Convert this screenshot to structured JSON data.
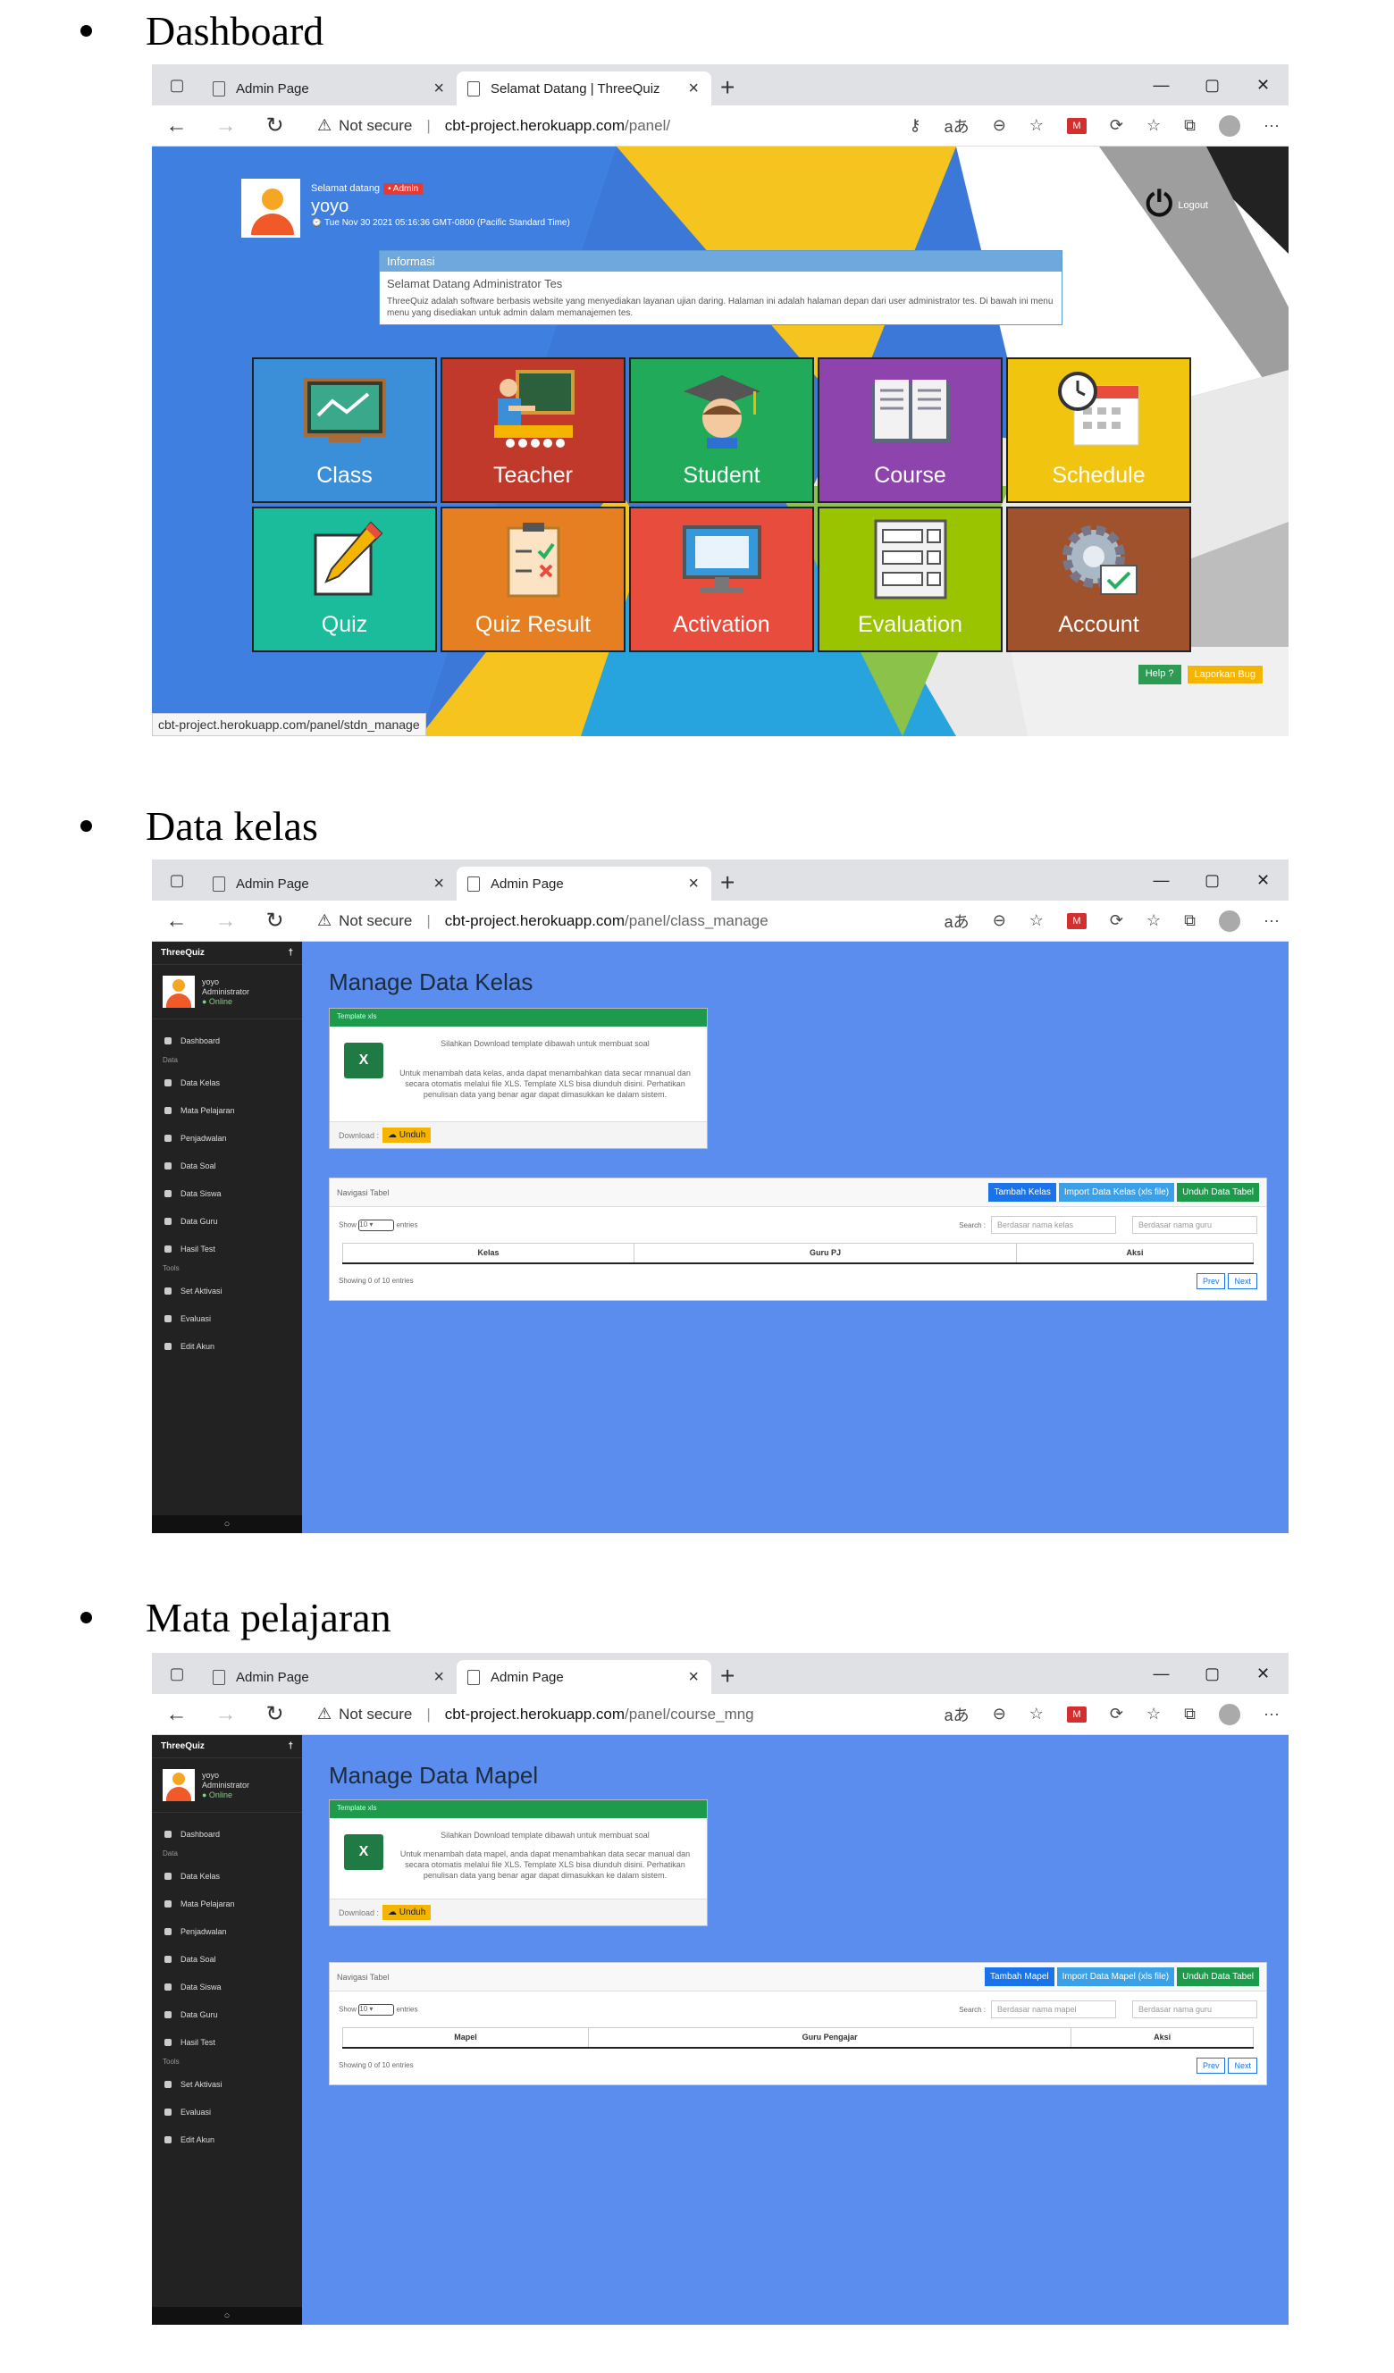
{
  "sections": [
    {
      "title": "Dashboard"
    },
    {
      "title": "Data kelas"
    },
    {
      "title": "Mata pelajaran"
    }
  ],
  "browser": {
    "tab1": "Admin Page",
    "tab2_dashboard": "Selamat Datang | ThreeQuiz",
    "tab2_admin": "Admin Page",
    "not_secure": "Not secure",
    "host": "cbt-project.herokuapp.com",
    "path_dashboard": "/panel/",
    "path_kelas": "/panel/class_manage",
    "path_mapel": "/panel/course_mng"
  },
  "dashboard": {
    "welcome": "Selamat datang",
    "role_badge": "• Admin",
    "username": "yoyo",
    "datetime": "⌚ Tue Nov 30 2021 05:16:36 GMT-0800 (Pacific Standard Time)",
    "logout": "Logout",
    "info_header": "Informasi",
    "info_title": "Selamat Datang Administrator Tes",
    "info_text": "ThreeQuiz adalah software berbasis website yang menyediakan layanan ujian daring. Halaman ini adalah halaman depan dari user administrator tes. Di bawah ini menu menu yang disediakan untuk admin dalam memanajemen tes.",
    "tiles": [
      {
        "label": "Class",
        "color": "#3b8fd8",
        "icon": "chart-board-icon"
      },
      {
        "label": "Teacher",
        "color": "#c0392b",
        "icon": "teacher-icon"
      },
      {
        "label": "Student",
        "color": "#22aa5b",
        "icon": "graduate-icon"
      },
      {
        "label": "Course",
        "color": "#8e44ad",
        "icon": "book-icon"
      },
      {
        "label": "Schedule",
        "color": "#f1c40f",
        "icon": "calendar-clock-icon"
      },
      {
        "label": "Quiz",
        "color": "#1abc9c",
        "icon": "pencil-paper-icon"
      },
      {
        "label": "Quiz Result",
        "color": "#e67e22",
        "icon": "checklist-icon"
      },
      {
        "label": "Activation",
        "color": "#e74c3c",
        "icon": "monitor-icon"
      },
      {
        "label": "Evaluation",
        "color": "#9bc400",
        "icon": "form-icon"
      },
      {
        "label": "Account",
        "color": "#a0522d",
        "icon": "gear-check-icon"
      }
    ],
    "help": "Help ?",
    "bug": "Laporkan Bug",
    "status_url": "cbt-project.herokuapp.com/panel/stdn_manage"
  },
  "sidebar": {
    "brand": "ThreeQuiz",
    "pin": "†",
    "user_name": "yoyo",
    "user_role": "Administrator",
    "user_status": "● Online",
    "dashboard": "Dashboard",
    "sec_data": "Data",
    "items_data": [
      "Data Kelas",
      "Mata Pelajaran",
      "Penjadwalan",
      "Data Soal",
      "Data Siswa",
      "Data Guru",
      "Hasil Test"
    ],
    "sec_tools": "Tools",
    "items_tools": [
      "Set Aktivasi",
      "Evaluasi",
      "Edit Akun"
    ],
    "foot": "○"
  },
  "kelas": {
    "title": "Manage Data Kelas",
    "tpl_head": "Template xls",
    "tpl_t1": "Silahkan Download template dibawah untuk membuat soal",
    "tpl_t2": "Untuk menambah data kelas, anda dapat menambahkan data secar mnanual dan secara otomatis melalui file XLS. Template XLS bisa diunduh disini. Perhatikan penulisan data yang benar agar dapat dimasukkan ke dalam sistem.",
    "download": "Download :",
    "unduh": "☁ Unduh",
    "nav": "Navigasi Tabel",
    "btn_add": "Tambah Kelas",
    "btn_import": "Import Data Kelas (xls file)",
    "btn_export": "Unduh Data Tabel",
    "show_pre": "Show",
    "show_val": "10",
    "show_post": "entries",
    "search": "Search :",
    "ph1": "Berdasar nama kelas",
    "ph2": "Berdasar nama guru",
    "cols": [
      "Kelas",
      "Guru PJ",
      "Aksi"
    ],
    "showing": "Showing 0 of 10 entries",
    "prev": "Prev",
    "next": "Next"
  },
  "mapel": {
    "title": "Manage Data Mapel",
    "tpl_head": "Template xls",
    "tpl_t1": "Silahkan Download template dibawah untuk membuat soal",
    "tpl_t2": "Untuk menambah data mapel, anda dapat menambahkan data secar manual dan secara otomatis melalui file XLS. Template XLS bisa diunduh disini. Perhatikan penulisan data yang benar agar dapat dimasukkan ke dalam sistem.",
    "download": "Download :",
    "unduh": "☁ Unduh",
    "nav": "Navigasi Tabel",
    "btn_add": "Tambah Mapel",
    "btn_import": "Import Data Mapel (xls file)",
    "btn_export": "Unduh Data Tabel",
    "show_pre": "Show",
    "show_val": "10",
    "show_post": "entries",
    "search": "Search :",
    "ph1": "Berdasar nama mapel",
    "ph2": "Berdasar nama guru",
    "cols": [
      "Mapel",
      "Guru Pengajar",
      "Aksi"
    ],
    "showing": "Showing 0 of 10 entries",
    "prev": "Prev",
    "next": "Next"
  }
}
